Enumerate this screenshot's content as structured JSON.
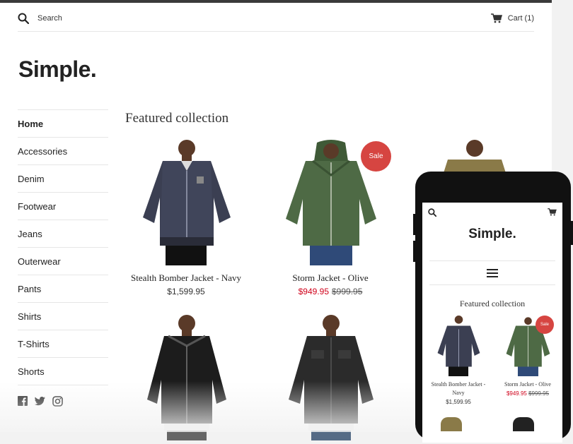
{
  "header": {
    "search_label": "Search",
    "cart_label": "Cart (1)"
  },
  "brand": {
    "name": "Simple."
  },
  "sidebar": {
    "items": [
      {
        "label": "Home",
        "active": true
      },
      {
        "label": "Accessories"
      },
      {
        "label": "Denim"
      },
      {
        "label": "Footwear"
      },
      {
        "label": "Jeans"
      },
      {
        "label": "Outerwear"
      },
      {
        "label": "Pants"
      },
      {
        "label": "Shirts"
      },
      {
        "label": "T-Shirts"
      },
      {
        "label": "Shorts"
      }
    ],
    "social": [
      "facebook-icon",
      "twitter-icon",
      "instagram-icon"
    ]
  },
  "collection": {
    "title": "Featured collection",
    "products": [
      {
        "name": "Stealth Bomber Jacket - Navy",
        "price": "$1,599.95",
        "color": "#3b3f52"
      },
      {
        "name": "Storm Jacket - Olive",
        "price": "$949.95",
        "compare_price": "$999.95",
        "badge": "Sale",
        "color": "#4e6a45"
      },
      {
        "name": "",
        "color": "#8a7a48"
      },
      {
        "name": "",
        "color": "#1c1c1c"
      },
      {
        "name": "",
        "color": "#2b2b2b"
      }
    ]
  },
  "mobile": {
    "logo": "Simple.",
    "title": "Featured collection",
    "products": [
      {
        "name": "Stealth Bomber Jacket - Navy",
        "price": "$1,599.95"
      },
      {
        "name": "Storm Jacket - Olive",
        "price": "$949.95",
        "compare_price": "$999.95",
        "badge": "Sale"
      }
    ]
  },
  "colors": {
    "sale_red": "#d64541",
    "price_red": "#d0021b",
    "text": "#222222"
  }
}
